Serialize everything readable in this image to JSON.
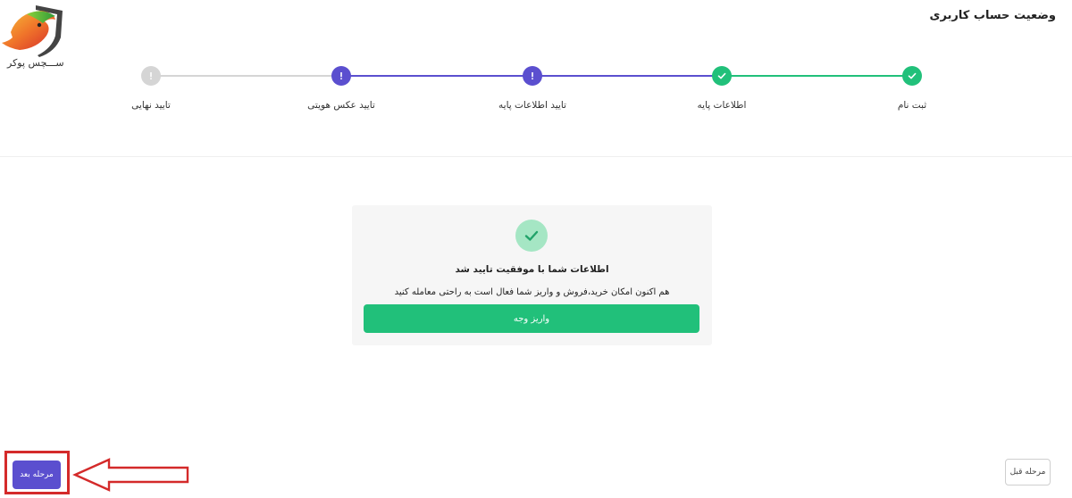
{
  "header": {
    "title": "وضعیت حساب کاربری",
    "logo_text": "ســـچس پوکر"
  },
  "stepper": {
    "steps": [
      {
        "label": "ثبت نام",
        "status": "completed"
      },
      {
        "label": "اطلاعات پایه",
        "status": "completed"
      },
      {
        "label": "تایید اطلاعات پایه",
        "status": "pending"
      },
      {
        "label": "تایید عکس هویتی",
        "status": "pending"
      },
      {
        "label": "تایید نهایی",
        "status": "inactive"
      }
    ]
  },
  "card": {
    "title": "اطلاعات شما با موفقیت تایید شد",
    "description": "هم اکنون امکان خرید،فروش و واریز شما فعال است به راحتی معامله کنید",
    "deposit_label": "واریز وجه"
  },
  "footer": {
    "next_label": "مرحله بعد",
    "prev_label": "مرحله قبل"
  },
  "colors": {
    "accent": "#5b4fcf",
    "success": "#21c07a",
    "success_light": "#a5e6c4",
    "inactive": "#d5d5d5",
    "annotation": "#d42a2a"
  }
}
